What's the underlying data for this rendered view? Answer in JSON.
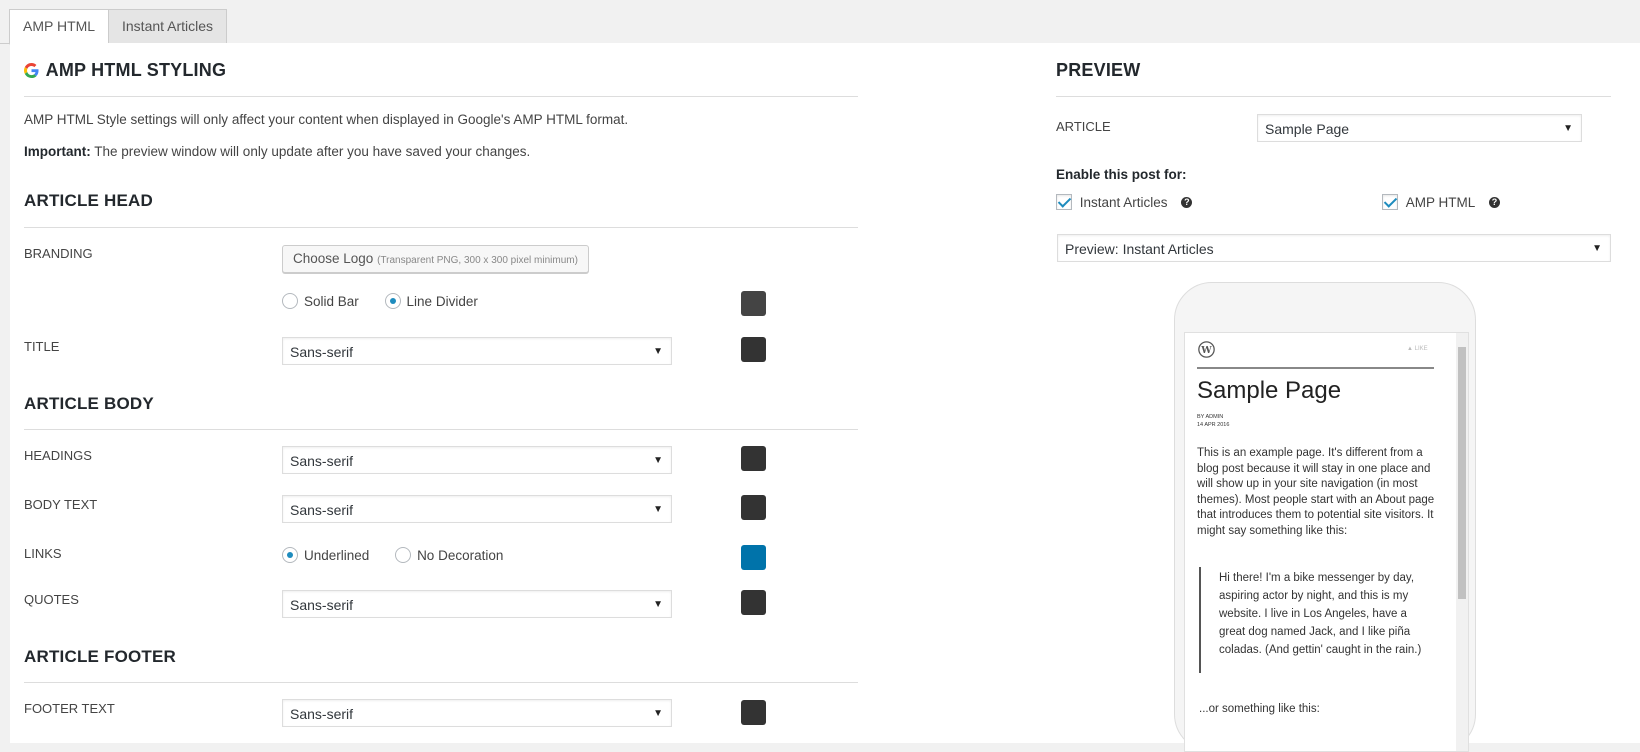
{
  "tabs": [
    {
      "label": "AMP HTML",
      "active": true
    },
    {
      "label": "Instant Articles",
      "active": false
    }
  ],
  "left": {
    "title": "AMP HTML STYLING",
    "intro": "AMP HTML Style settings will only affect your content when displayed in Google's AMP HTML format.",
    "important_label": "Important:",
    "important_text": " The preview window will only update after you have saved your changes.",
    "sections": {
      "head": "ARTICLE HEAD",
      "body": "ARTICLE BODY",
      "footer": "ARTICLE FOOTER"
    },
    "branding": {
      "label": "BRANDING",
      "button": "Choose Logo",
      "button_hint": "(Transparent PNG, 300 x 300 pixel minimum)",
      "options": [
        "Solid Bar",
        "Line Divider"
      ],
      "selected": "Line Divider",
      "color": "#444444"
    },
    "title_row": {
      "label": "TITLE",
      "value": "Sans-serif",
      "color": "#333333"
    },
    "headings": {
      "label": "HEADINGS",
      "value": "Sans-serif",
      "color": "#333333"
    },
    "body_text": {
      "label": "BODY TEXT",
      "value": "Sans-serif",
      "color": "#333333"
    },
    "links": {
      "label": "LINKS",
      "options": [
        "Underlined",
        "No Decoration"
      ],
      "selected": "Underlined",
      "color": "#0073aa"
    },
    "quotes": {
      "label": "QUOTES",
      "value": "Sans-serif",
      "color": "#333333"
    },
    "footer_text": {
      "label": "FOOTER TEXT",
      "value": "Sans-serif",
      "color": "#333333"
    }
  },
  "right": {
    "title": "PREVIEW",
    "article_label": "ARTICLE",
    "article_value": "Sample Page",
    "enable_label": "Enable this post for:",
    "enable_options": [
      {
        "label": "Instant Articles",
        "checked": true
      },
      {
        "label": "AMP HTML",
        "checked": true
      }
    ],
    "preview_select": "Preview: Instant Articles",
    "phone": {
      "like_label": "LIKE",
      "page_title": "Sample Page",
      "byline": "BY ADMIN",
      "date": "14 APR 2016",
      "paragraph": "This is an example page. It's different from a blog post because it will stay in one place and will show up in your site navigation (in most themes). Most people start with an About page that introduces them to potential site visitors. It might say something like this:",
      "quote": "Hi there! I'm a bike messenger by day, aspiring actor by night, and this is my website. I live in Los Angeles, have a great dog named Jack, and I like piña coladas. (And gettin' caught in the rain.)",
      "after": "...or something like this:"
    }
  },
  "colors": {
    "accent": "#1e8cbe",
    "link_blue": "#0073aa",
    "swatch_dark": "#333333"
  }
}
